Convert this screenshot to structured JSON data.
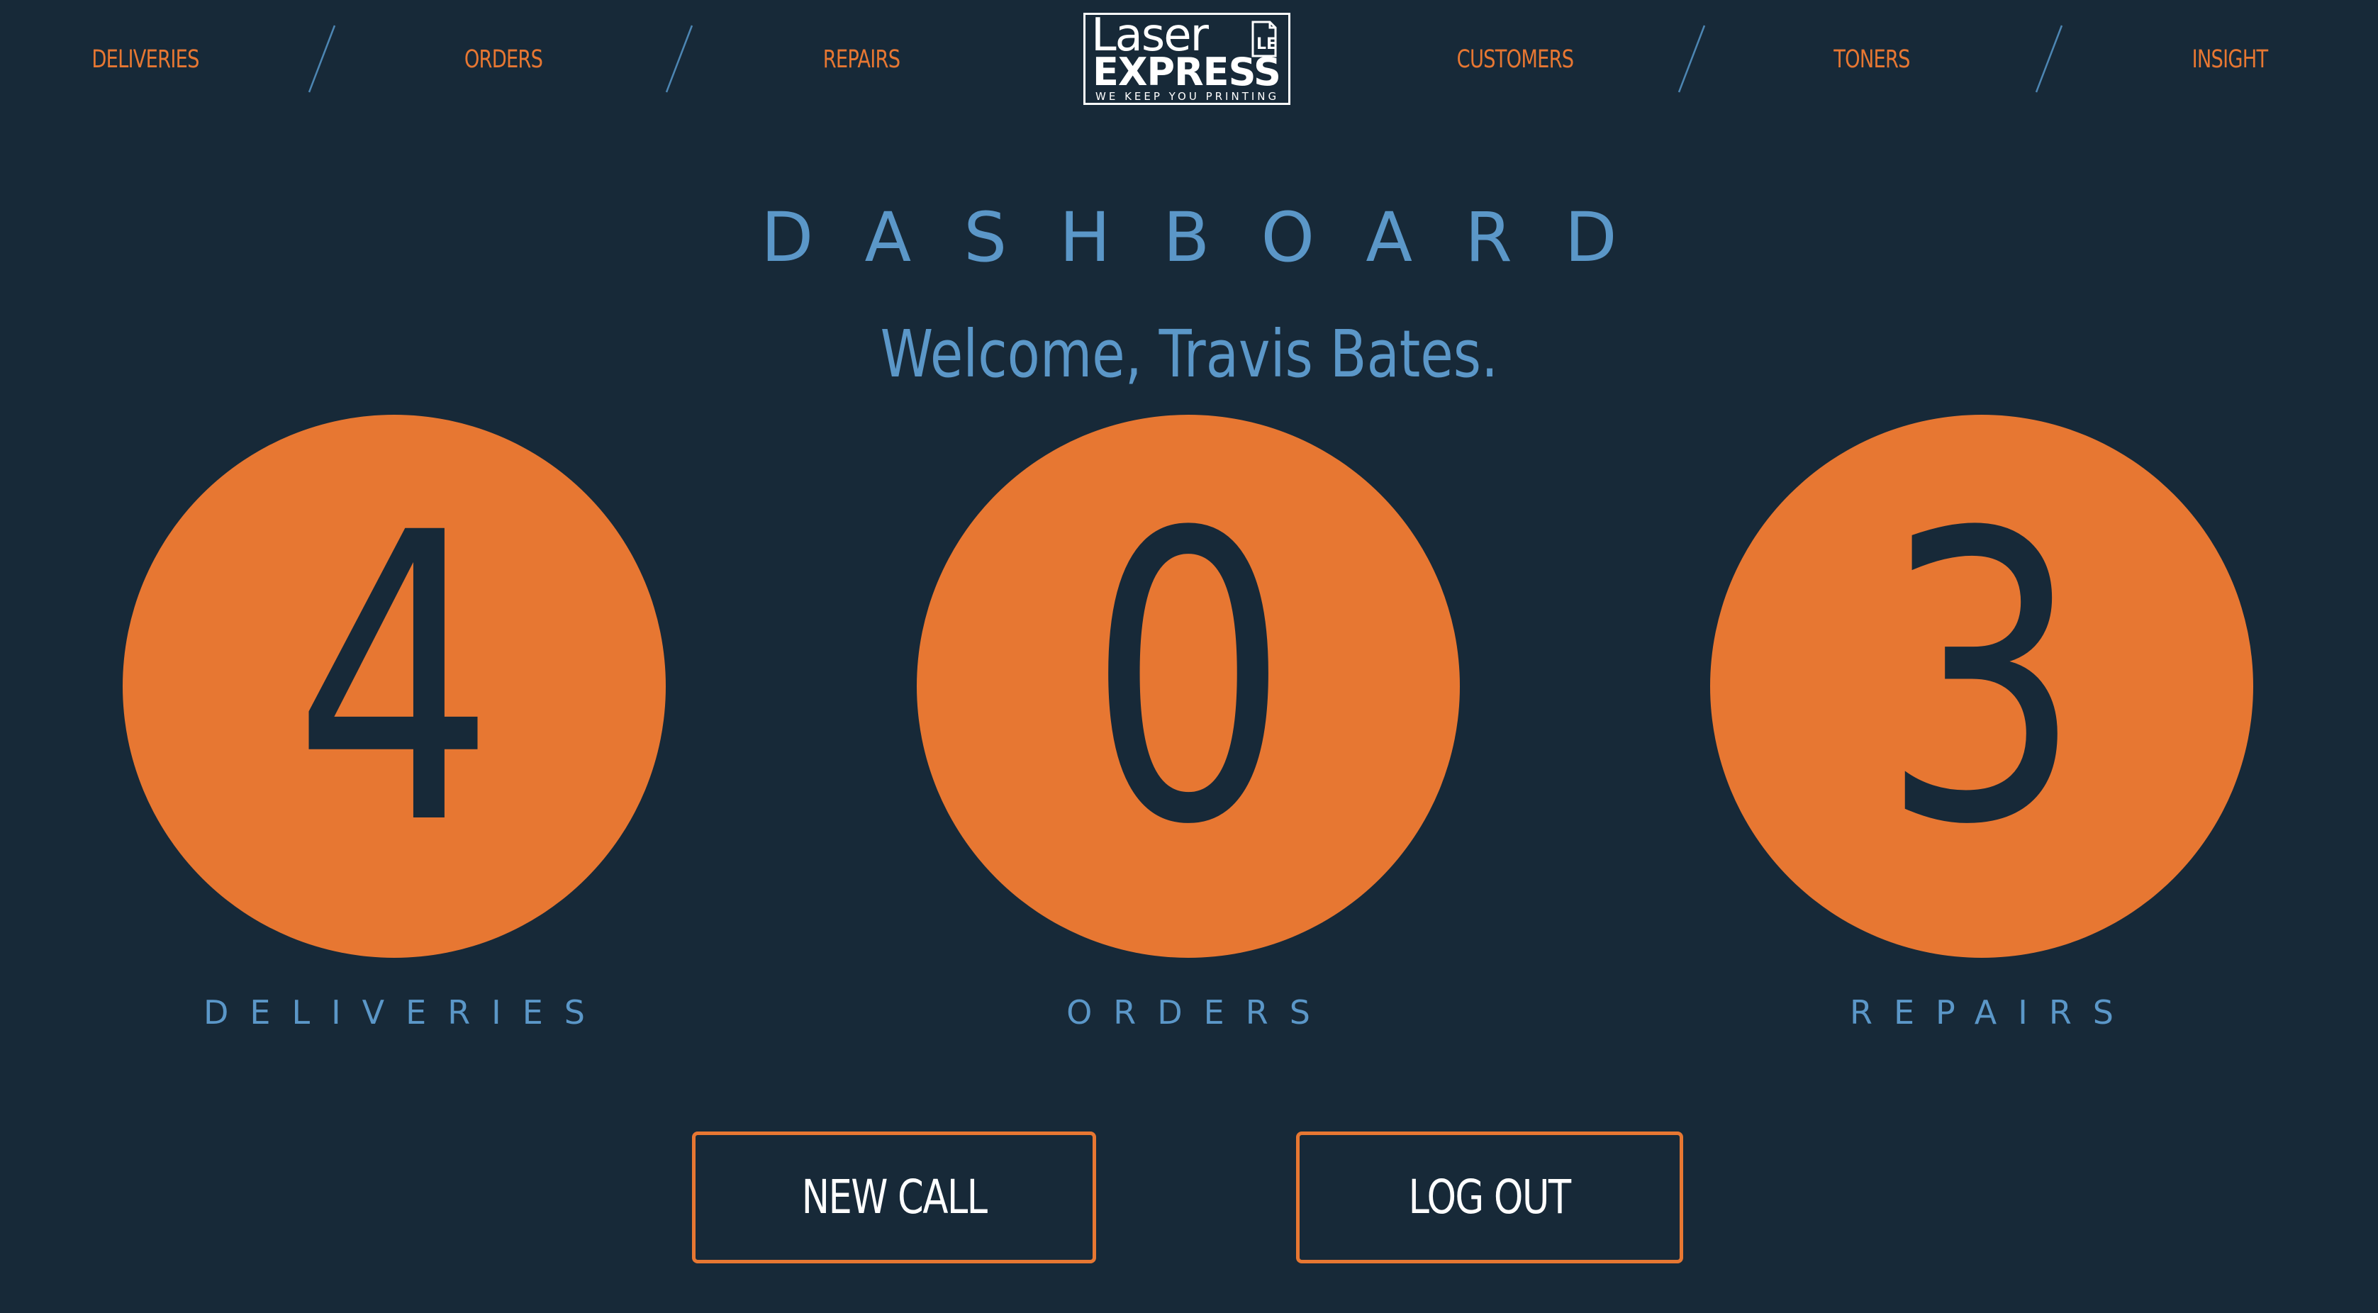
{
  "nav": {
    "left": [
      {
        "label": "DELIVERIES"
      },
      {
        "label": "ORDERS"
      },
      {
        "label": "REPAIRS"
      }
    ],
    "right": [
      {
        "label": "CUSTOMERS"
      },
      {
        "label": "TONERS"
      },
      {
        "label": "INSIGHT"
      }
    ]
  },
  "logo": {
    "word": "Laser",
    "brand": "EXPRESS",
    "tagline": "WE KEEP YOU PRINTING",
    "mark": "LE"
  },
  "page_title": "DASHBOARD",
  "welcome": "Welcome, Travis Bates.",
  "stats": [
    {
      "value": "4",
      "label": "DELIVERIES"
    },
    {
      "value": "0",
      "label": "ORDERS"
    },
    {
      "value": "3",
      "label": "REPAIRS"
    }
  ],
  "actions": {
    "new_call": "NEW CALL",
    "log_out": "LOG OUT"
  },
  "colors": {
    "background": "#172938",
    "accent": "#e77732",
    "heading": "#5b97c8",
    "separator": "#4d86b3",
    "button_text": "#ffffff"
  }
}
